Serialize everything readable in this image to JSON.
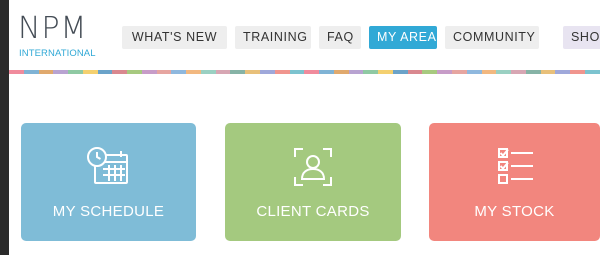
{
  "logo": {
    "mark": "NPM",
    "subtitle": "INTERNATIONAL"
  },
  "nav": {
    "items": [
      {
        "label": "WHAT'S NEW"
      },
      {
        "label": "TRAINING"
      },
      {
        "label": "FAQ"
      },
      {
        "label": "MY AREA",
        "active": true
      },
      {
        "label": "COMMUNITY"
      },
      {
        "label": "SHOP"
      }
    ]
  },
  "tiles": [
    {
      "label": "MY SCHEDULE",
      "icon": "calendar-clock-icon",
      "color": "#7fbcd7"
    },
    {
      "label": "CLIENT CARDS",
      "icon": "client-card-icon",
      "color": "#a4c97f"
    },
    {
      "label": "MY STOCK",
      "icon": "checklist-icon",
      "color": "#f2867e"
    }
  ],
  "colors": {
    "accent": "#31a9d6",
    "strip": [
      "#f08b9c",
      "#7fb3d5",
      "#e0a96d",
      "#b8a3d1",
      "#8fc9a3",
      "#f4d06f",
      "#6ba3c9",
      "#d9888f",
      "#a7c97f",
      "#c79cc8",
      "#e6a5a0",
      "#8fb8de",
      "#f2b880",
      "#9ad0c2",
      "#d7a6b3",
      "#86b3a6",
      "#e8c07a",
      "#9fa8da",
      "#f0958e",
      "#7cc3cf"
    ]
  }
}
